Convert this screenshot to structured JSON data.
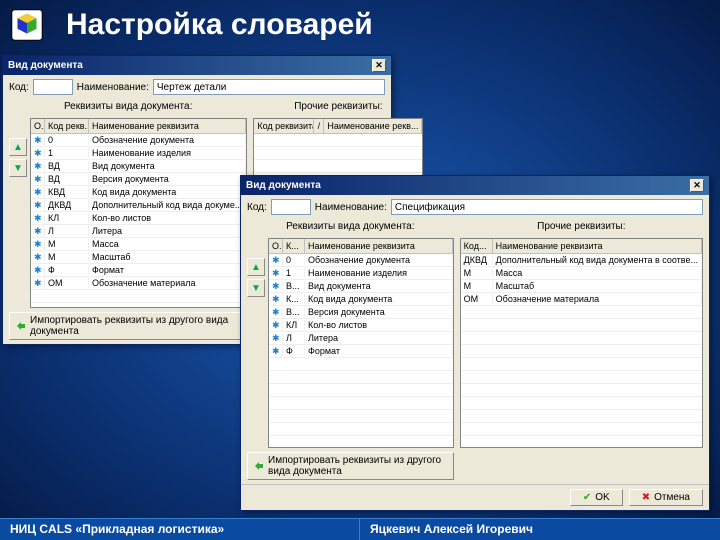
{
  "page": {
    "title": "Настройка словарей",
    "footer_left": "НИЦ CALS «Прикладная логистика»",
    "footer_right": "Яцкевич Алексей Игоревич"
  },
  "dialog1": {
    "title": "Вид документа",
    "code_label": "Код:",
    "name_label": "Наименование:",
    "code_value": "",
    "name_value": "Чертеж детали",
    "left_section_title": "Реквизиты вида документа:",
    "right_section_title": "Прочие реквизиты:",
    "grid_headers": {
      "status": "О...",
      "code": "Код рекв...",
      "name": "Наименование реквизита"
    },
    "right_headers": {
      "code": "Код реквизита",
      "sep": "/",
      "name": "Наименование рекв..."
    },
    "rows": [
      {
        "code": "0",
        "name": "Обозначение документа"
      },
      {
        "code": "1",
        "name": "Наименование изделия"
      },
      {
        "code": "ВД",
        "name": "Вид документа"
      },
      {
        "code": "ВД",
        "name": "Версия документа"
      },
      {
        "code": "КВД",
        "name": "Код вида документа"
      },
      {
        "code": "ДКВД",
        "name": "Дополнительный код вида докуме..."
      },
      {
        "code": "КЛ",
        "name": "Кол-во листов"
      },
      {
        "code": "Л",
        "name": "Литера"
      },
      {
        "code": "М",
        "name": "Масса"
      },
      {
        "code": "М",
        "name": "Масштаб"
      },
      {
        "code": "Ф",
        "name": "Формат"
      },
      {
        "code": "ОМ",
        "name": "Обозначение материала"
      }
    ],
    "import_label": "Импортировать реквизиты из другого вида документа"
  },
  "dialog2": {
    "title": "Вид документа",
    "code_label": "Код:",
    "name_label": "Наименование:",
    "code_value": "",
    "name_value": "Спецификация",
    "left_section_title": "Реквизиты вида документа:",
    "right_section_title": "Прочие реквизиты:",
    "grid_headers": {
      "status": "О...",
      "code": "К...",
      "name": "Наименование реквизита"
    },
    "right_headers": {
      "code": "Код...",
      "name": "Наименование реквизита"
    },
    "rows_left": [
      {
        "code": "0",
        "name": "Обозначение документа"
      },
      {
        "code": "1",
        "name": "Наименование изделия"
      },
      {
        "code": "В...",
        "name": "Вид документа"
      },
      {
        "code": "К...",
        "name": "Код вида документа"
      },
      {
        "code": "В...",
        "name": "Версия документа"
      },
      {
        "code": "КЛ",
        "name": "Кол-во листов"
      },
      {
        "code": "Л",
        "name": "Литера"
      },
      {
        "code": "Ф",
        "name": "Формат"
      }
    ],
    "rows_right": [
      {
        "code": "ДКВД",
        "name": "Дополнительный код вида документа в соотве..."
      },
      {
        "code": "М",
        "name": "Масса"
      },
      {
        "code": "М",
        "name": "Масштаб"
      },
      {
        "code": "ОМ",
        "name": "Обозначение материала"
      }
    ],
    "import_label": "Импортировать реквизиты из другого вида документа",
    "ok_label": "OK",
    "cancel_label": "Отмена"
  }
}
